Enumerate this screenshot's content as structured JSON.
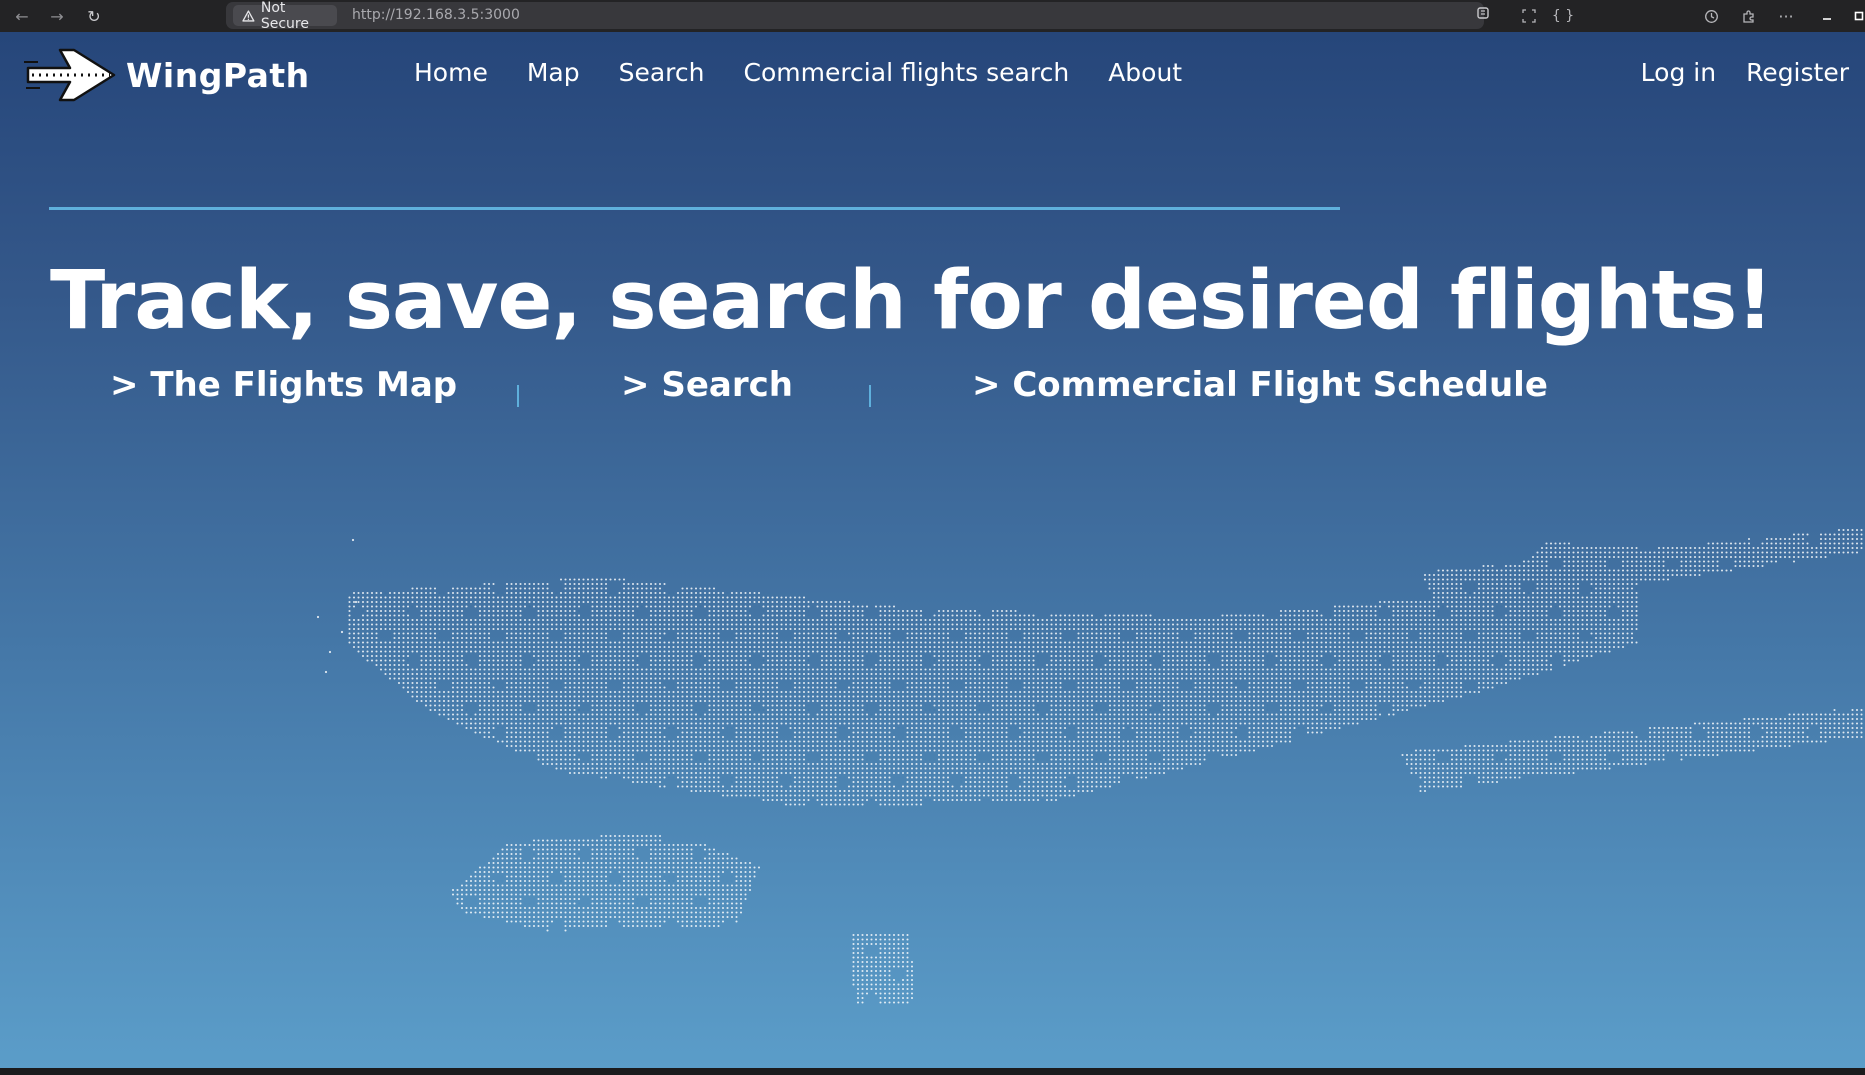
{
  "browser": {
    "security_label": "Not Secure",
    "url_host": "http://192.168.3.5",
    "url_port": ":3000",
    "icons": {
      "back": "arrow-left-icon",
      "forward": "arrow-right-icon",
      "reload": "reload-icon",
      "security": "warning-triangle-icon",
      "reader": "reader-icon",
      "screenshot": "screenshot-icon",
      "devtools": "braces-icon",
      "history": "history-icon",
      "extensions": "puzzle-icon",
      "menu": "more-icon",
      "minimize": "minimize-icon",
      "maximize": "maximize-icon"
    }
  },
  "header": {
    "brand": "WingPath",
    "nav": {
      "home": "Home",
      "map": "Map",
      "search": "Search",
      "commercial": "Commercial flights search",
      "about": "About"
    },
    "auth": {
      "login": "Log in",
      "register": "Register"
    }
  },
  "hero": {
    "headline": "Track, save, search for desired flights!",
    "links": {
      "map": "> The Flights Map",
      "search": "> Search",
      "schedule": "> Commercial Flight Schedule"
    }
  },
  "theme": {
    "gradient_top": "#26467a",
    "gradient_bottom": "#5b9dc9",
    "accent": "#5fb0dc",
    "text": "#ffffff"
  }
}
